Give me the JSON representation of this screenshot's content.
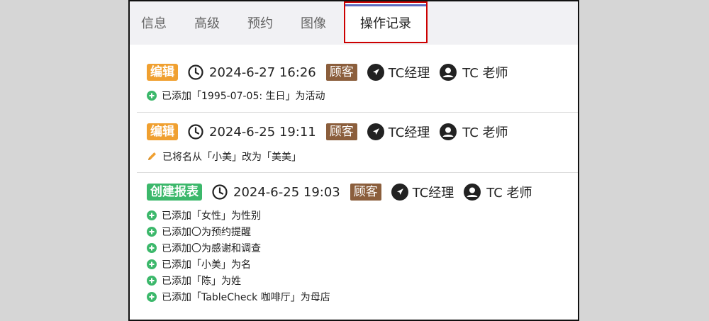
{
  "tabs": [
    {
      "label": "信息"
    },
    {
      "label": "高级"
    },
    {
      "label": "预约"
    },
    {
      "label": "图像"
    },
    {
      "label": "操作记录",
      "active": true
    }
  ],
  "entries": [
    {
      "badge": "编辑",
      "badge_color": "#f0a030",
      "datetime": "2024-6-27 16:26",
      "customer": "顾客",
      "role": "TC经理",
      "staff": "TC 老师",
      "changes": [
        {
          "icon": "plus-circle-icon",
          "text": "已添加「1995-07-05: 生日」为活动"
        }
      ]
    },
    {
      "badge": "编辑",
      "badge_color": "#f0a030",
      "datetime": "2024-6-25 19:11",
      "customer": "顾客",
      "role": "TC经理",
      "staff": "TC 老师",
      "changes": [
        {
          "icon": "pencil-icon",
          "text": "已将名从「小美」改为「美美」"
        }
      ]
    },
    {
      "badge": "创建报表",
      "badge_color": "#3cb86b",
      "datetime": "2024-6-25 19:03",
      "customer": "顾客",
      "role": "TC经理",
      "staff": "TC 老师",
      "changes": [
        {
          "icon": "plus-circle-icon",
          "text": "已添加「女性」为性别"
        },
        {
          "icon": "plus-circle-icon",
          "text": "已添加〇为预约提醒"
        },
        {
          "icon": "plus-circle-icon",
          "text": "已添加〇为感谢和调查"
        },
        {
          "icon": "plus-circle-icon",
          "text": "已添加「小美」为名"
        },
        {
          "icon": "plus-circle-icon",
          "text": "已添加「陈」为姓"
        },
        {
          "icon": "plus-circle-icon",
          "text": "已添加「TableCheck 咖啡厅」为母店"
        }
      ]
    }
  ]
}
